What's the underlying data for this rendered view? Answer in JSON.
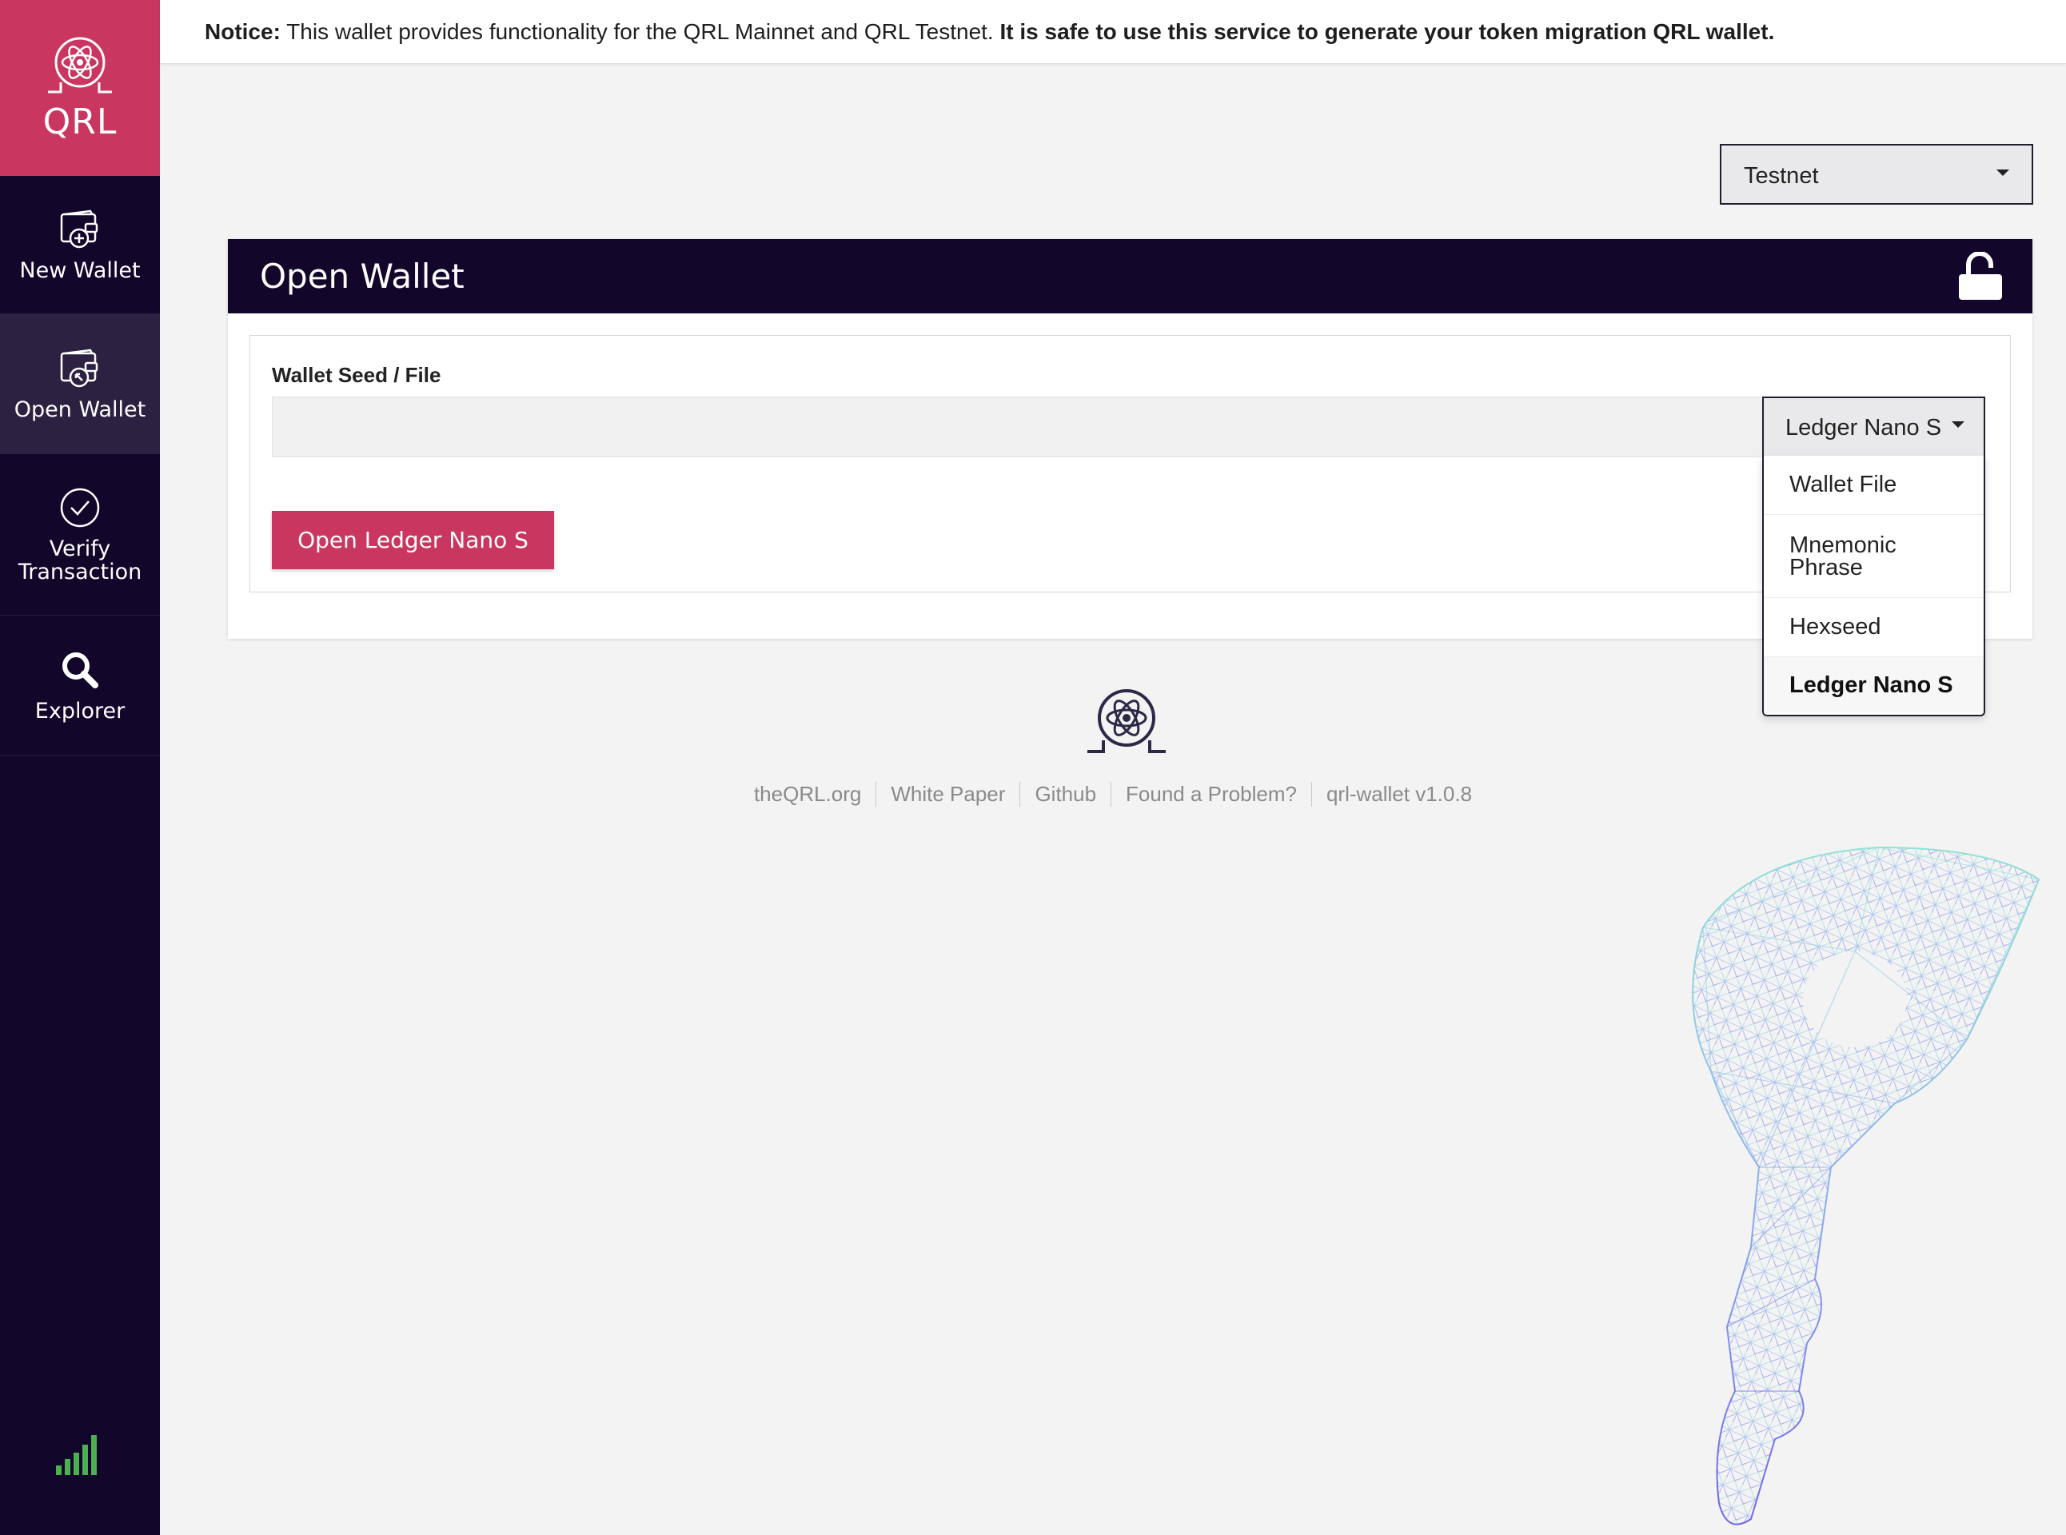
{
  "brand": {
    "name": "QRL"
  },
  "sidebar": {
    "items": [
      {
        "label": "New Wallet",
        "icon": "wallet-plus-icon"
      },
      {
        "label": "Open Wallet",
        "icon": "wallet-open-icon",
        "active": true
      },
      {
        "label_line1": "Verify",
        "label_line2": "Transaction",
        "icon": "check-circle-icon"
      },
      {
        "label": "Explorer",
        "icon": "search-icon"
      }
    ],
    "status_icon": "signal-strength-icon"
  },
  "notice": {
    "prefix": "Notice:",
    "text": " This wallet provides functionality for the QRL Mainnet and QRL Testnet. ",
    "emphasis": "It is safe to use this service to generate your token migration QRL wallet."
  },
  "network": {
    "selected": "Testnet"
  },
  "card": {
    "title": "Open Wallet",
    "header_icon": "unlock-icon",
    "field_label": "Wallet Seed / File",
    "seed_value": "",
    "source_selected": "Ledger Nano S",
    "options": [
      "Wallet File",
      "Mnemonic Phrase",
      "Hexseed",
      "Ledger Nano S"
    ],
    "option_2_line1": "Mnemonic",
    "option_2_line2": "Phrase",
    "button_label": "Open Ledger Nano S"
  },
  "footer": {
    "links": [
      "theQRL.org",
      "White Paper",
      "Github",
      "Found a Problem?",
      "qrl-wallet v1.0.8"
    ]
  },
  "colors": {
    "brand": "#c9365f",
    "sidebar": "#12062a",
    "background": "#f3f3f3",
    "signal": "#4caf50"
  }
}
